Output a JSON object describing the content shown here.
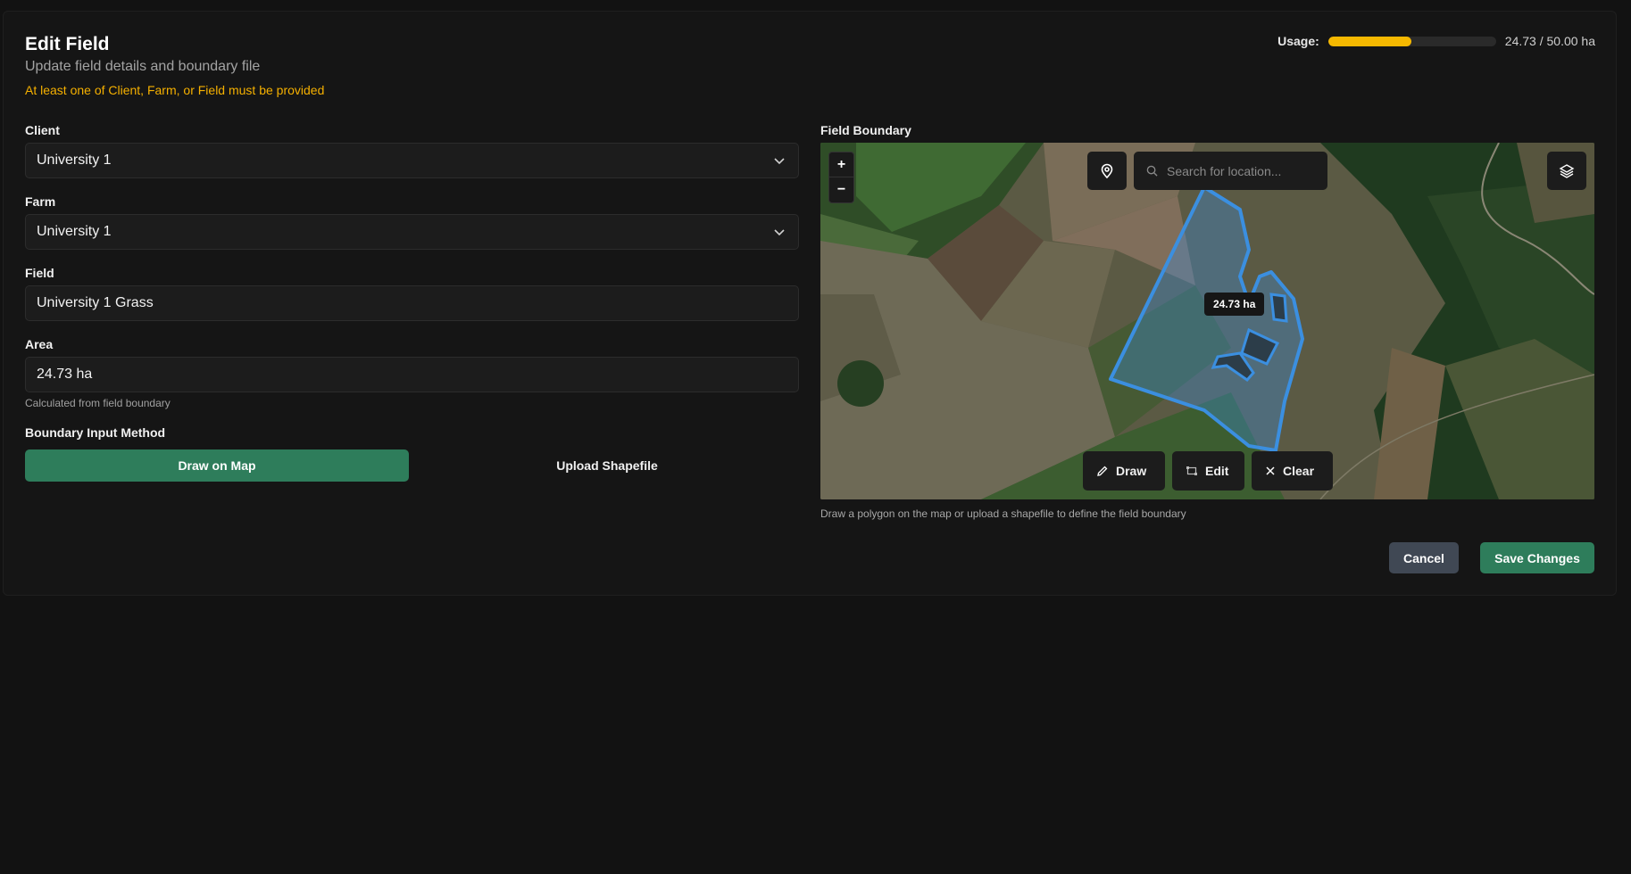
{
  "header": {
    "title": "Edit Field",
    "subtitle": "Update field details and boundary file",
    "warning": "At least one of Client, Farm, or Field must be provided"
  },
  "usage": {
    "label": "Usage:",
    "used": 24.73,
    "limit": 50.0,
    "value_text": "24.73 / 50.00 ha"
  },
  "form": {
    "client": {
      "label": "Client",
      "value": "University 1"
    },
    "farm": {
      "label": "Farm",
      "value": "University 1"
    },
    "field": {
      "label": "Field",
      "value": "University 1 Grass"
    },
    "area": {
      "label": "Area",
      "value": "24.73 ha",
      "hint": "Calculated from field boundary"
    },
    "boundary_method": {
      "label": "Boundary Input Method",
      "options": [
        "Draw on Map",
        "Upload Shapefile"
      ],
      "selected": "Draw on Map"
    }
  },
  "map": {
    "label": "Field Boundary",
    "search_placeholder": "Search for location...",
    "zoom_in": "+",
    "zoom_out": "−",
    "area_tag": "24.73 ha",
    "tools": {
      "draw": "Draw",
      "edit": "Edit",
      "clear": "Clear"
    },
    "hint": "Draw a polygon on the map or upload a shapefile to define the field boundary",
    "boundary_color": "#3b8fe0",
    "icons": [
      "map-pin-icon",
      "search-icon",
      "layers-icon",
      "pencil-icon",
      "edit-shape-icon",
      "x-icon"
    ]
  },
  "actions": {
    "cancel": "Cancel",
    "save": "Save Changes"
  },
  "colors": {
    "accent_green": "#2e7d5b",
    "warning_yellow": "#f5b000",
    "usage_bar": "#f5b800"
  }
}
